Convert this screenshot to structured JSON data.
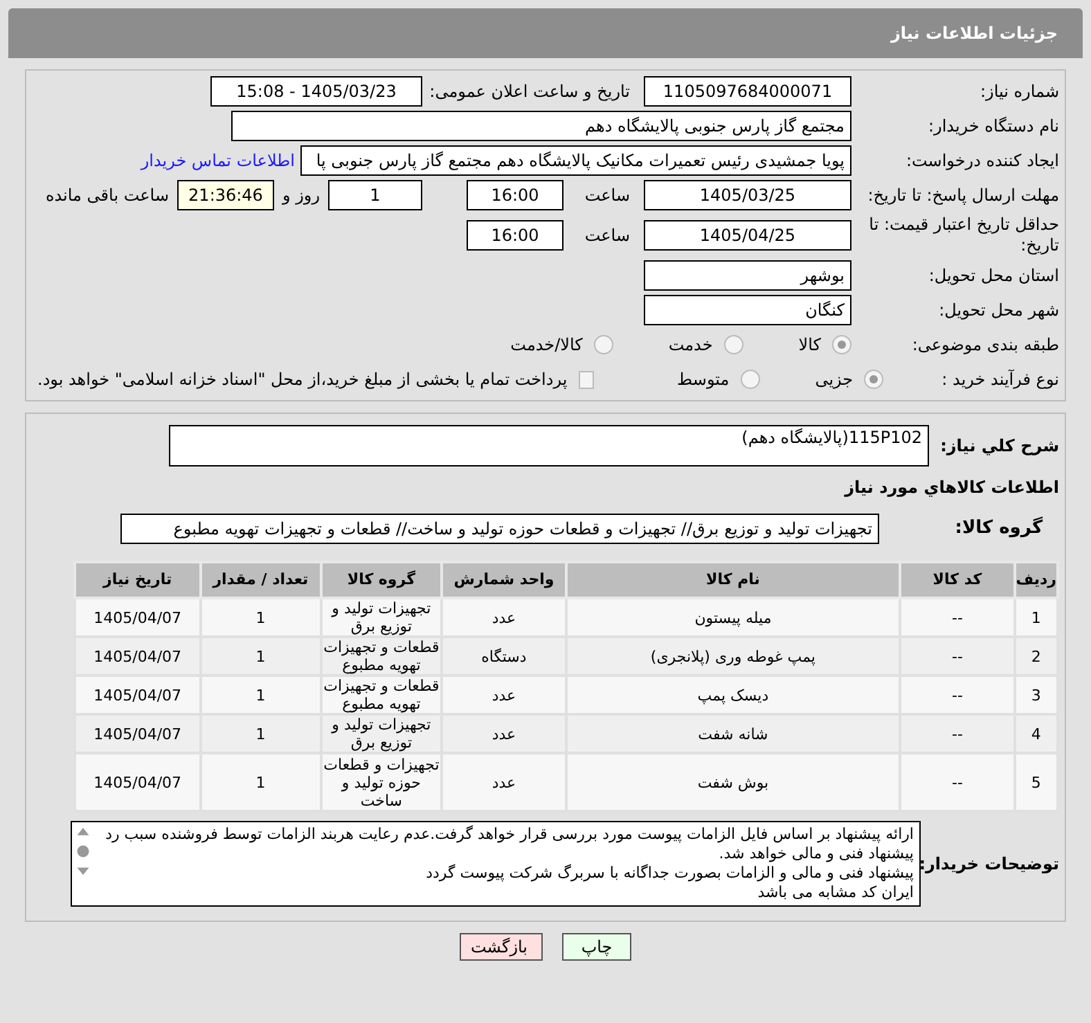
{
  "header": {
    "title": "جزئیات اطلاعات نیاز"
  },
  "need_number": {
    "label": "شماره نیاز:",
    "value": "1105097684000071"
  },
  "announce": {
    "label": "تاریخ و ساعت اعلان عمومی:",
    "value": "1405/03/23 - 15:08"
  },
  "buyer_org": {
    "label": "نام دستگاه خریدار:",
    "value": "مجتمع گاز پارس جنوبی  پالایشگاه دهم"
  },
  "requester": {
    "label": "ایجاد کننده درخواست:",
    "value": "پویا جمشیدی رئیس تعمیرات مکانیک پالایشگاه دهم  مجتمع گاز پارس جنوبی  پا",
    "link": "اطلاعات تماس خریدار"
  },
  "deadline": {
    "label": "مهلت ارسال پاسخ: تا تاریخ:",
    "date": "1405/03/25",
    "time_label": "ساعت",
    "time": "16:00",
    "days": "1",
    "days_label": "روز و",
    "remaining": "21:36:46",
    "remaining_label": "ساعت باقی مانده"
  },
  "price_validity": {
    "label": "حداقل تاریخ اعتبار قیمت: تا تاریخ:",
    "date": "1405/04/25",
    "time_label": "ساعت",
    "time": "16:00"
  },
  "province": {
    "label": "استان محل تحویل:",
    "value": "بوشهر"
  },
  "city": {
    "label": "شهر محل تحویل:",
    "value": "کنگان"
  },
  "category": {
    "label": "طبقه بندی موضوعی:",
    "options": [
      {
        "label": "کالا",
        "selected": true
      },
      {
        "label": "خدمت",
        "selected": false
      },
      {
        "label": "کالا/خدمت",
        "selected": false
      }
    ]
  },
  "process": {
    "label": "نوع فرآیند خرید :",
    "options": [
      {
        "label": "جزیی",
        "selected": true
      },
      {
        "label": "متوسط",
        "selected": false
      }
    ],
    "payment": {
      "label": "پرداخت تمام یا بخشی از مبلغ خرید،از محل \"اسناد خزانه اسلامی\" خواهد بود.",
      "checked": false
    }
  },
  "description": {
    "label": "شرح كلي نياز:",
    "value": "115P102(پالایشگاه دهم)"
  },
  "goods_title": "اطلاعات كالاهاي مورد نياز",
  "goods_group": {
    "label": "گروه کالا:",
    "value": "تجهیزات تولید و توزیع برق// تجهیزات و قطعات حوزه تولید و ساخت//  قطعات و تجهیزات تهویه مطبوع"
  },
  "table": {
    "columns": [
      "ردیف",
      "کد کالا",
      "نام کالا",
      "واحد شمارش",
      "گروه کالا",
      "تعداد / مقدار",
      "تاریخ نیاز"
    ],
    "rows": [
      [
        "1",
        "--",
        "میله پیستون",
        "عدد",
        "تجهیزات تولید و توزیع برق",
        "1",
        "1405/04/07"
      ],
      [
        "2",
        "--",
        "پمپ غوطه وری (پلانجری)",
        "دستگاه",
        "قطعات و تجهیزات تهویه مطبوع",
        "1",
        "1405/04/07"
      ],
      [
        "3",
        "--",
        "دیسک پمپ",
        "عدد",
        "قطعات و تجهیزات تهویه مطبوع",
        "1",
        "1405/04/07"
      ],
      [
        "4",
        "--",
        "شانه شفت",
        "عدد",
        "تجهیزات تولید و توزیع برق",
        "1",
        "1405/04/07"
      ],
      [
        "5",
        "--",
        "بوش شفت",
        "عدد",
        "تجهیزات و قطعات حوزه تولید و ساخت",
        "1",
        "1405/04/07"
      ]
    ]
  },
  "buyer_notes": {
    "label": "توضیحات خریدار:",
    "lines": [
      "ارائه پیشنهاد بر اساس فایل الزامات پیوست مورد بررسی قرار خواهد گرفت.عدم رعایت هربند الزامات توسط فروشنده سبب رد پیشنهاد فنی و مالی خواهد شد.",
      "پیشنهاد فنی و مالی و الزامات بصورت جداگانه با سربرگ شرکت پیوست گردد",
      "ایران کد مشابه می باشد"
    ]
  },
  "buttons": [
    {
      "label": "چاپ",
      "kind": "print"
    },
    {
      "label": "بازگشت",
      "kind": "back"
    }
  ]
}
